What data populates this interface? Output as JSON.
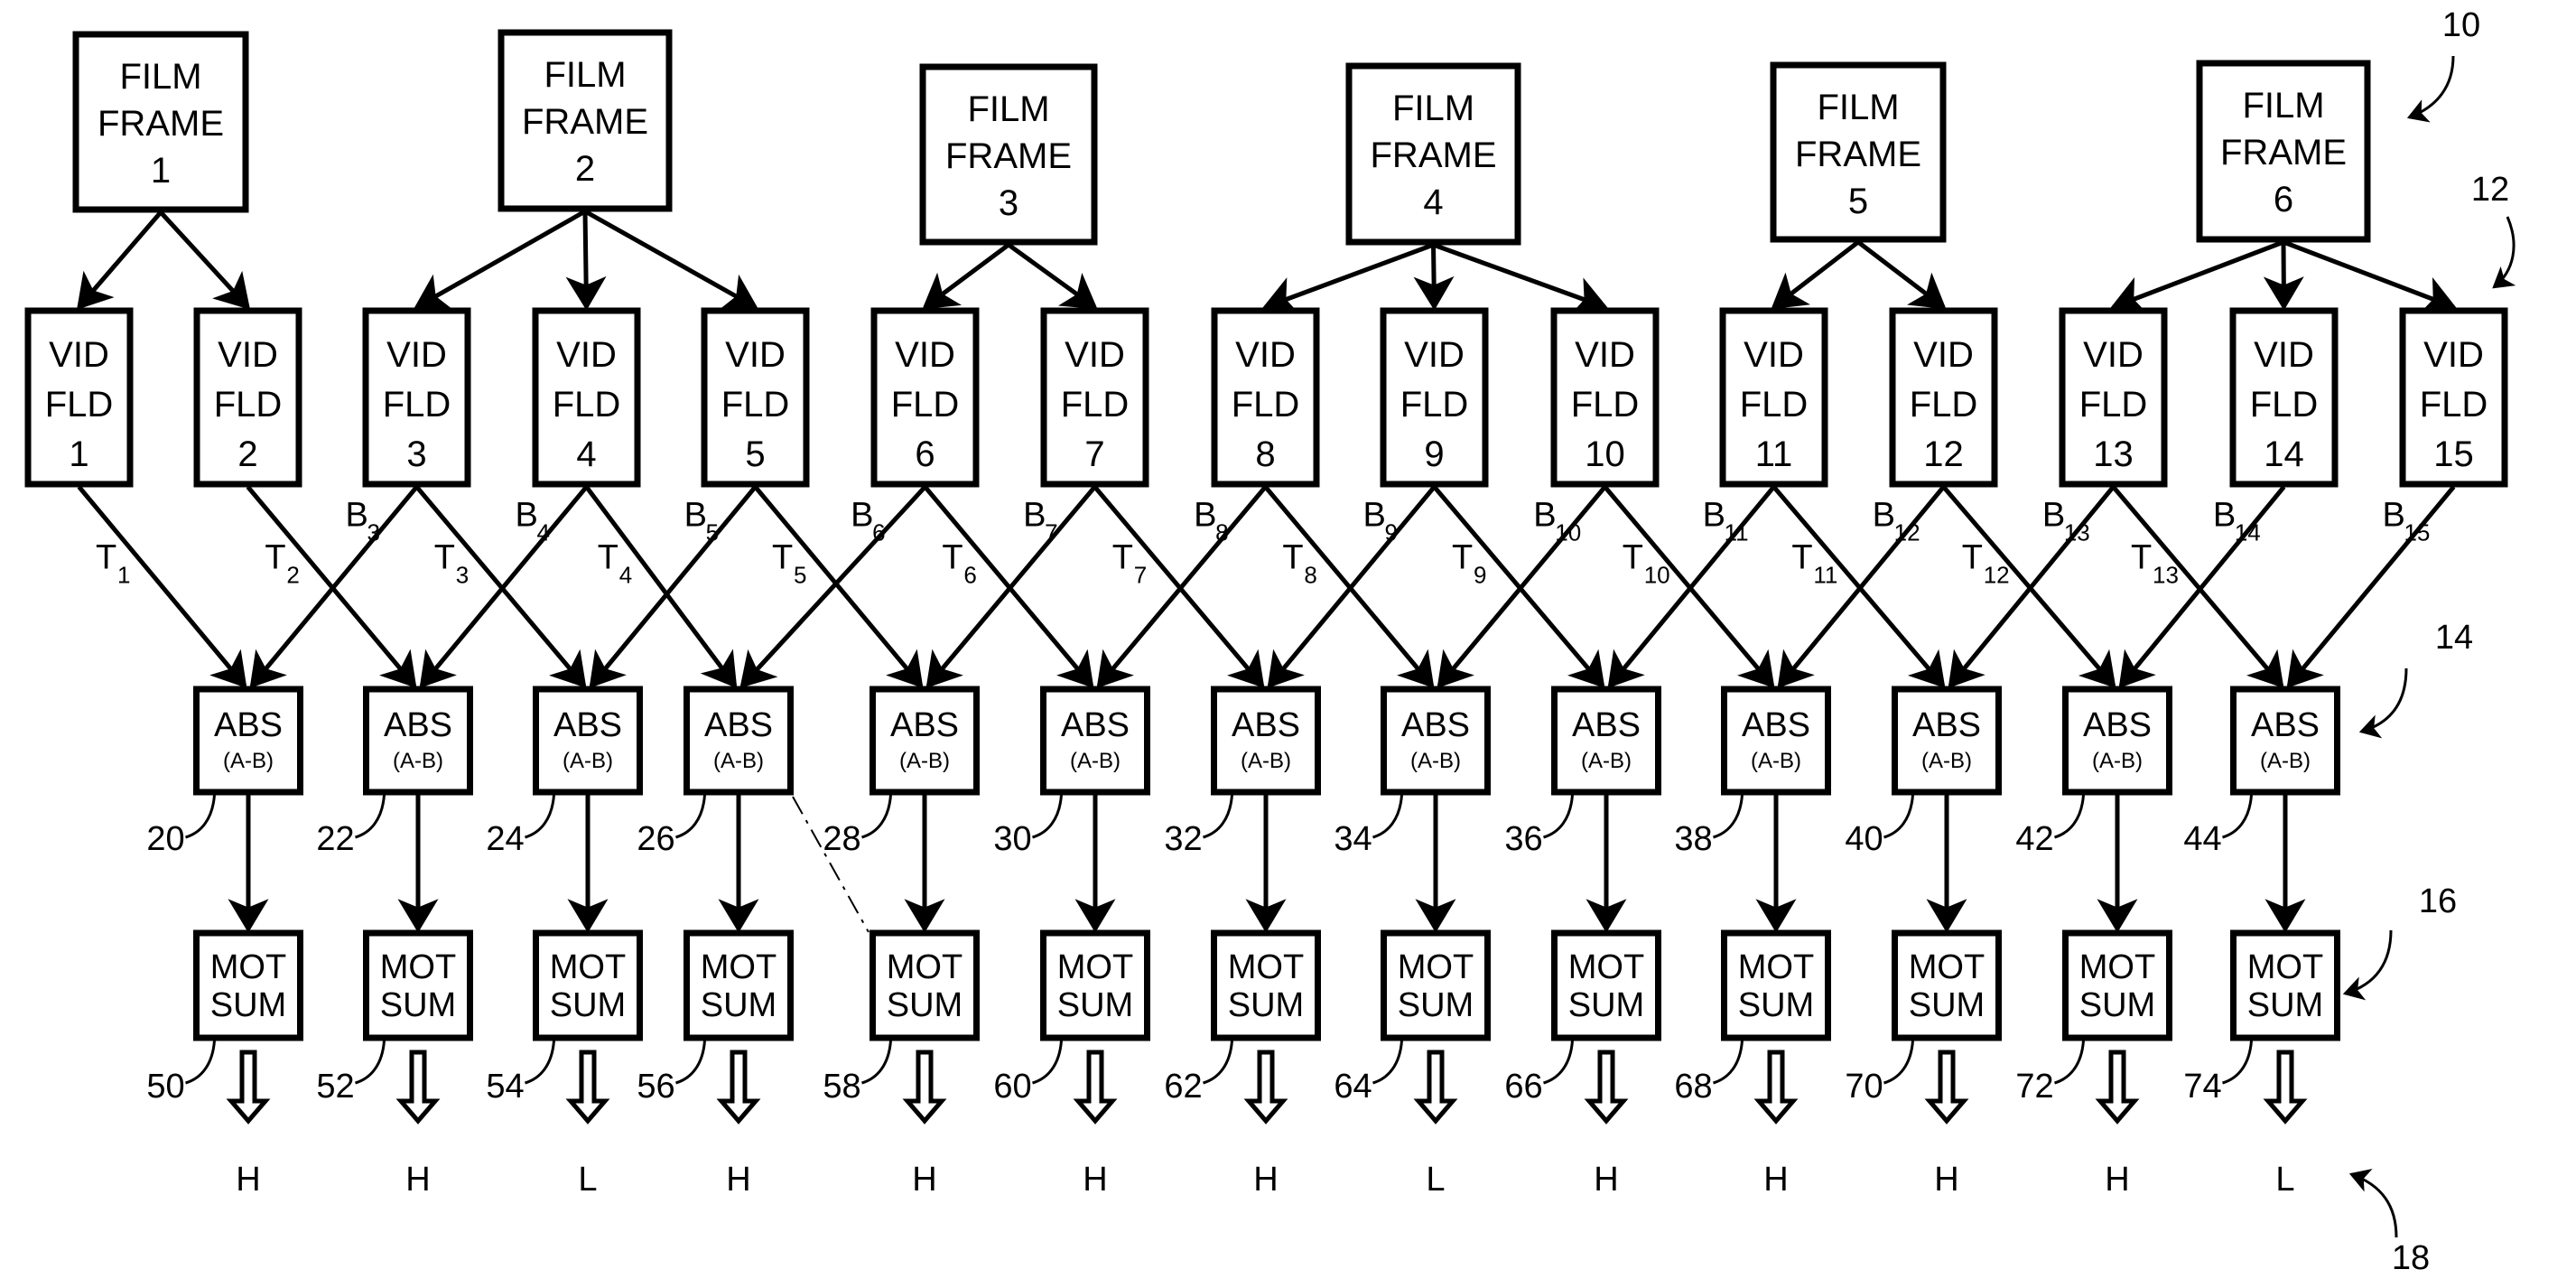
{
  "figure": {
    "film_frames": [
      {
        "lines": [
          "FILM",
          "FRAME",
          "1"
        ],
        "children": [
          1,
          2
        ]
      },
      {
        "lines": [
          "FILM",
          "FRAME",
          "2"
        ],
        "children": [
          3,
          4,
          5
        ]
      },
      {
        "lines": [
          "FILM",
          "FRAME",
          "3"
        ],
        "children": [
          6,
          7
        ]
      },
      {
        "lines": [
          "FILM",
          "FRAME",
          "4"
        ],
        "children": [
          8,
          9,
          10
        ]
      },
      {
        "lines": [
          "FILM",
          "FRAME",
          "5"
        ],
        "children": [
          11,
          12
        ]
      },
      {
        "lines": [
          "FILM",
          "FRAME",
          "6"
        ],
        "children": [
          13,
          14,
          15
        ]
      }
    ],
    "video_fields": [
      {
        "lines": [
          "VID",
          "FLD",
          "1"
        ]
      },
      {
        "lines": [
          "VID",
          "FLD",
          "2"
        ]
      },
      {
        "lines": [
          "VID",
          "FLD",
          "3"
        ]
      },
      {
        "lines": [
          "VID",
          "FLD",
          "4"
        ]
      },
      {
        "lines": [
          "VID",
          "FLD",
          "5"
        ]
      },
      {
        "lines": [
          "VID",
          "FLD",
          "6"
        ]
      },
      {
        "lines": [
          "VID",
          "FLD",
          "7"
        ]
      },
      {
        "lines": [
          "VID",
          "FLD",
          "8"
        ]
      },
      {
        "lines": [
          "VID",
          "FLD",
          "9"
        ]
      },
      {
        "lines": [
          "VID",
          "FLD",
          "10"
        ]
      },
      {
        "lines": [
          "VID",
          "FLD",
          "11"
        ]
      },
      {
        "lines": [
          "VID",
          "FLD",
          "12"
        ]
      },
      {
        "lines": [
          "VID",
          "FLD",
          "13"
        ]
      },
      {
        "lines": [
          "VID",
          "FLD",
          "14"
        ]
      },
      {
        "lines": [
          "VID",
          "FLD",
          "15"
        ]
      }
    ],
    "field_links": [
      {
        "type": "T",
        "sub": "1",
        "from_field": 1,
        "to_abs": 1
      },
      {
        "type": "T",
        "sub": "2",
        "from_field": 2,
        "to_abs": 2
      },
      {
        "type": "T",
        "sub": "3",
        "from_field": 3,
        "to_abs": 3
      },
      {
        "type": "T",
        "sub": "4",
        "from_field": 4,
        "to_abs": 4
      },
      {
        "type": "T",
        "sub": "5",
        "from_field": 5,
        "to_abs": 5
      },
      {
        "type": "T",
        "sub": "6",
        "from_field": 6,
        "to_abs": 6
      },
      {
        "type": "T",
        "sub": "7",
        "from_field": 7,
        "to_abs": 7
      },
      {
        "type": "T",
        "sub": "8",
        "from_field": 8,
        "to_abs": 8
      },
      {
        "type": "T",
        "sub": "9",
        "from_field": 9,
        "to_abs": 9
      },
      {
        "type": "T",
        "sub": "10",
        "from_field": 10,
        "to_abs": 10
      },
      {
        "type": "T",
        "sub": "11",
        "from_field": 11,
        "to_abs": 11
      },
      {
        "type": "T",
        "sub": "12",
        "from_field": 12,
        "to_abs": 12
      },
      {
        "type": "T",
        "sub": "13",
        "from_field": 13,
        "to_abs": 13
      },
      {
        "type": "B",
        "sub": "3",
        "from_field": 3,
        "to_abs": 1
      },
      {
        "type": "B",
        "sub": "4",
        "from_field": 4,
        "to_abs": 2
      },
      {
        "type": "B",
        "sub": "5",
        "from_field": 5,
        "to_abs": 3
      },
      {
        "type": "B",
        "sub": "6",
        "from_field": 6,
        "to_abs": 4
      },
      {
        "type": "B",
        "sub": "7",
        "from_field": 7,
        "to_abs": 5
      },
      {
        "type": "B",
        "sub": "8",
        "from_field": 8,
        "to_abs": 6
      },
      {
        "type": "B",
        "sub": "9",
        "from_field": 9,
        "to_abs": 7
      },
      {
        "type": "B",
        "sub": "10",
        "from_field": 10,
        "to_abs": 8
      },
      {
        "type": "B",
        "sub": "11",
        "from_field": 11,
        "to_abs": 9
      },
      {
        "type": "B",
        "sub": "12",
        "from_field": 12,
        "to_abs": 10
      },
      {
        "type": "B",
        "sub": "13",
        "from_field": 13,
        "to_abs": 11
      },
      {
        "type": "B",
        "sub": "14",
        "from_field": 14,
        "to_abs": 12
      },
      {
        "type": "B",
        "sub": "15",
        "from_field": 15,
        "to_abs": 13
      }
    ],
    "abs_blocks": [
      {
        "title": "ABS",
        "sub": "(A-B)",
        "ref": "20"
      },
      {
        "title": "ABS",
        "sub": "(A-B)",
        "ref": "22"
      },
      {
        "title": "ABS",
        "sub": "(A-B)",
        "ref": "24"
      },
      {
        "title": "ABS",
        "sub": "(A-B)",
        "ref": "26"
      },
      {
        "title": "ABS",
        "sub": "(A-B)",
        "ref": "28"
      },
      {
        "title": "ABS",
        "sub": "(A-B)",
        "ref": "30"
      },
      {
        "title": "ABS",
        "sub": "(A-B)",
        "ref": "32"
      },
      {
        "title": "ABS",
        "sub": "(A-B)",
        "ref": "34"
      },
      {
        "title": "ABS",
        "sub": "(A-B)",
        "ref": "36"
      },
      {
        "title": "ABS",
        "sub": "(A-B)",
        "ref": "38"
      },
      {
        "title": "ABS",
        "sub": "(A-B)",
        "ref": "40"
      },
      {
        "title": "ABS",
        "sub": "(A-B)",
        "ref": "42"
      },
      {
        "title": "ABS",
        "sub": "(A-B)",
        "ref": "44"
      }
    ],
    "mot_sum_blocks": [
      {
        "lines": [
          "MOT",
          "SUM"
        ],
        "ref": "50",
        "output": "H"
      },
      {
        "lines": [
          "MOT",
          "SUM"
        ],
        "ref": "52",
        "output": "H"
      },
      {
        "lines": [
          "MOT",
          "SUM"
        ],
        "ref": "54",
        "output": "L"
      },
      {
        "lines": [
          "MOT",
          "SUM"
        ],
        "ref": "56",
        "output": "H"
      },
      {
        "lines": [
          "MOT",
          "SUM"
        ],
        "ref": "58",
        "output": "H"
      },
      {
        "lines": [
          "MOT",
          "SUM"
        ],
        "ref": "60",
        "output": "H"
      },
      {
        "lines": [
          "MOT",
          "SUM"
        ],
        "ref": "62",
        "output": "H"
      },
      {
        "lines": [
          "MOT",
          "SUM"
        ],
        "ref": "64",
        "output": "L"
      },
      {
        "lines": [
          "MOT",
          "SUM"
        ],
        "ref": "66",
        "output": "H"
      },
      {
        "lines": [
          "MOT",
          "SUM"
        ],
        "ref": "68",
        "output": "H"
      },
      {
        "lines": [
          "MOT",
          "SUM"
        ],
        "ref": "70",
        "output": "H"
      },
      {
        "lines": [
          "MOT",
          "SUM"
        ],
        "ref": "72",
        "output": "H"
      },
      {
        "lines": [
          "MOT",
          "SUM"
        ],
        "ref": "74",
        "output": "L"
      }
    ],
    "group_refs": {
      "film_frames": "10",
      "video_fields": "12",
      "abs_row": "14",
      "mot_sum_row": "16",
      "outputs": "18"
    }
  }
}
